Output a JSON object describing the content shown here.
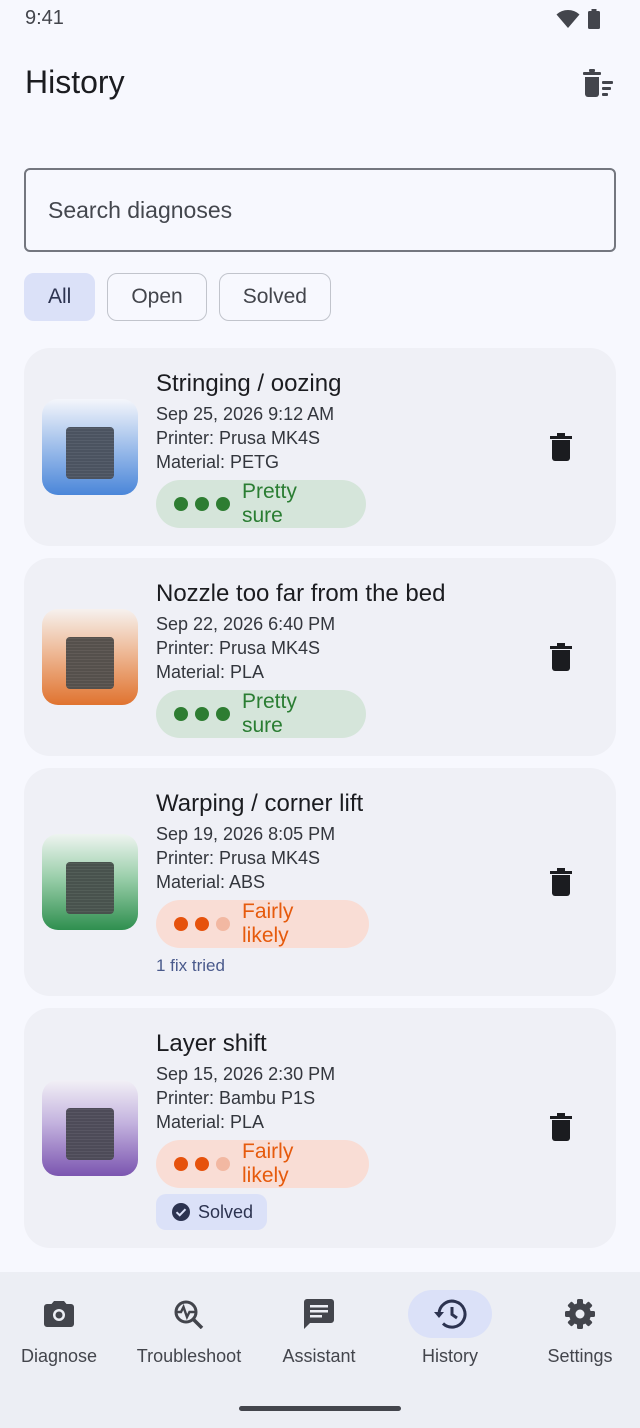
{
  "status": {
    "time": "9:41"
  },
  "header": {
    "title": "History"
  },
  "search": {
    "placeholder": "Search diagnoses",
    "value": ""
  },
  "filters": [
    {
      "label": "All",
      "active": true
    },
    {
      "label": "Open",
      "active": false
    },
    {
      "label": "Solved",
      "active": false
    }
  ],
  "diagnoses": [
    {
      "title": "Stringing / oozing",
      "datetime": "Sep 25, 2026 9:12 AM",
      "printer": "Printer: Prusa MK4S",
      "material": "Material: PETG",
      "confidence": "Pretty sure",
      "confidence_level": 3,
      "thumb_color": "#4a86d9"
    },
    {
      "title": "Nozzle too far from the bed",
      "datetime": "Sep 22, 2026 6:40 PM",
      "printer": "Printer: Prusa MK4S",
      "material": "Material: PLA",
      "confidence": "Pretty sure",
      "confidence_level": 3,
      "thumb_color": "#e0732f"
    },
    {
      "title": "Warping / corner lift",
      "datetime": "Sep 19, 2026 8:05 PM",
      "printer": "Printer: Prusa MK4S",
      "material": "Material: ABS",
      "confidence": "Fairly likely",
      "confidence_level": 2,
      "fixes": "1 fix tried",
      "thumb_color": "#2f8f4f"
    },
    {
      "title": "Layer shift",
      "datetime": "Sep 15, 2026 2:30 PM",
      "printer": "Printer: Bambu P1S",
      "material": "Material: PLA",
      "confidence": "Fairly likely",
      "confidence_level": 2,
      "solved": "Solved",
      "thumb_color": "#7b55b0"
    }
  ],
  "nav": [
    {
      "label": "Diagnose",
      "icon": "camera-icon",
      "active": false
    },
    {
      "label": "Troubleshoot",
      "icon": "troubleshoot-icon",
      "active": false
    },
    {
      "label": "Assistant",
      "icon": "chat-icon",
      "active": false
    },
    {
      "label": "History",
      "icon": "history-icon",
      "active": true
    },
    {
      "label": "Settings",
      "icon": "gear-icon",
      "active": false
    }
  ],
  "colors": {
    "background": "#f7f8fe",
    "card": "#eff0f6",
    "accent": "#dbe1f8",
    "green": "#2e7d32",
    "orange": "#e6520c"
  }
}
